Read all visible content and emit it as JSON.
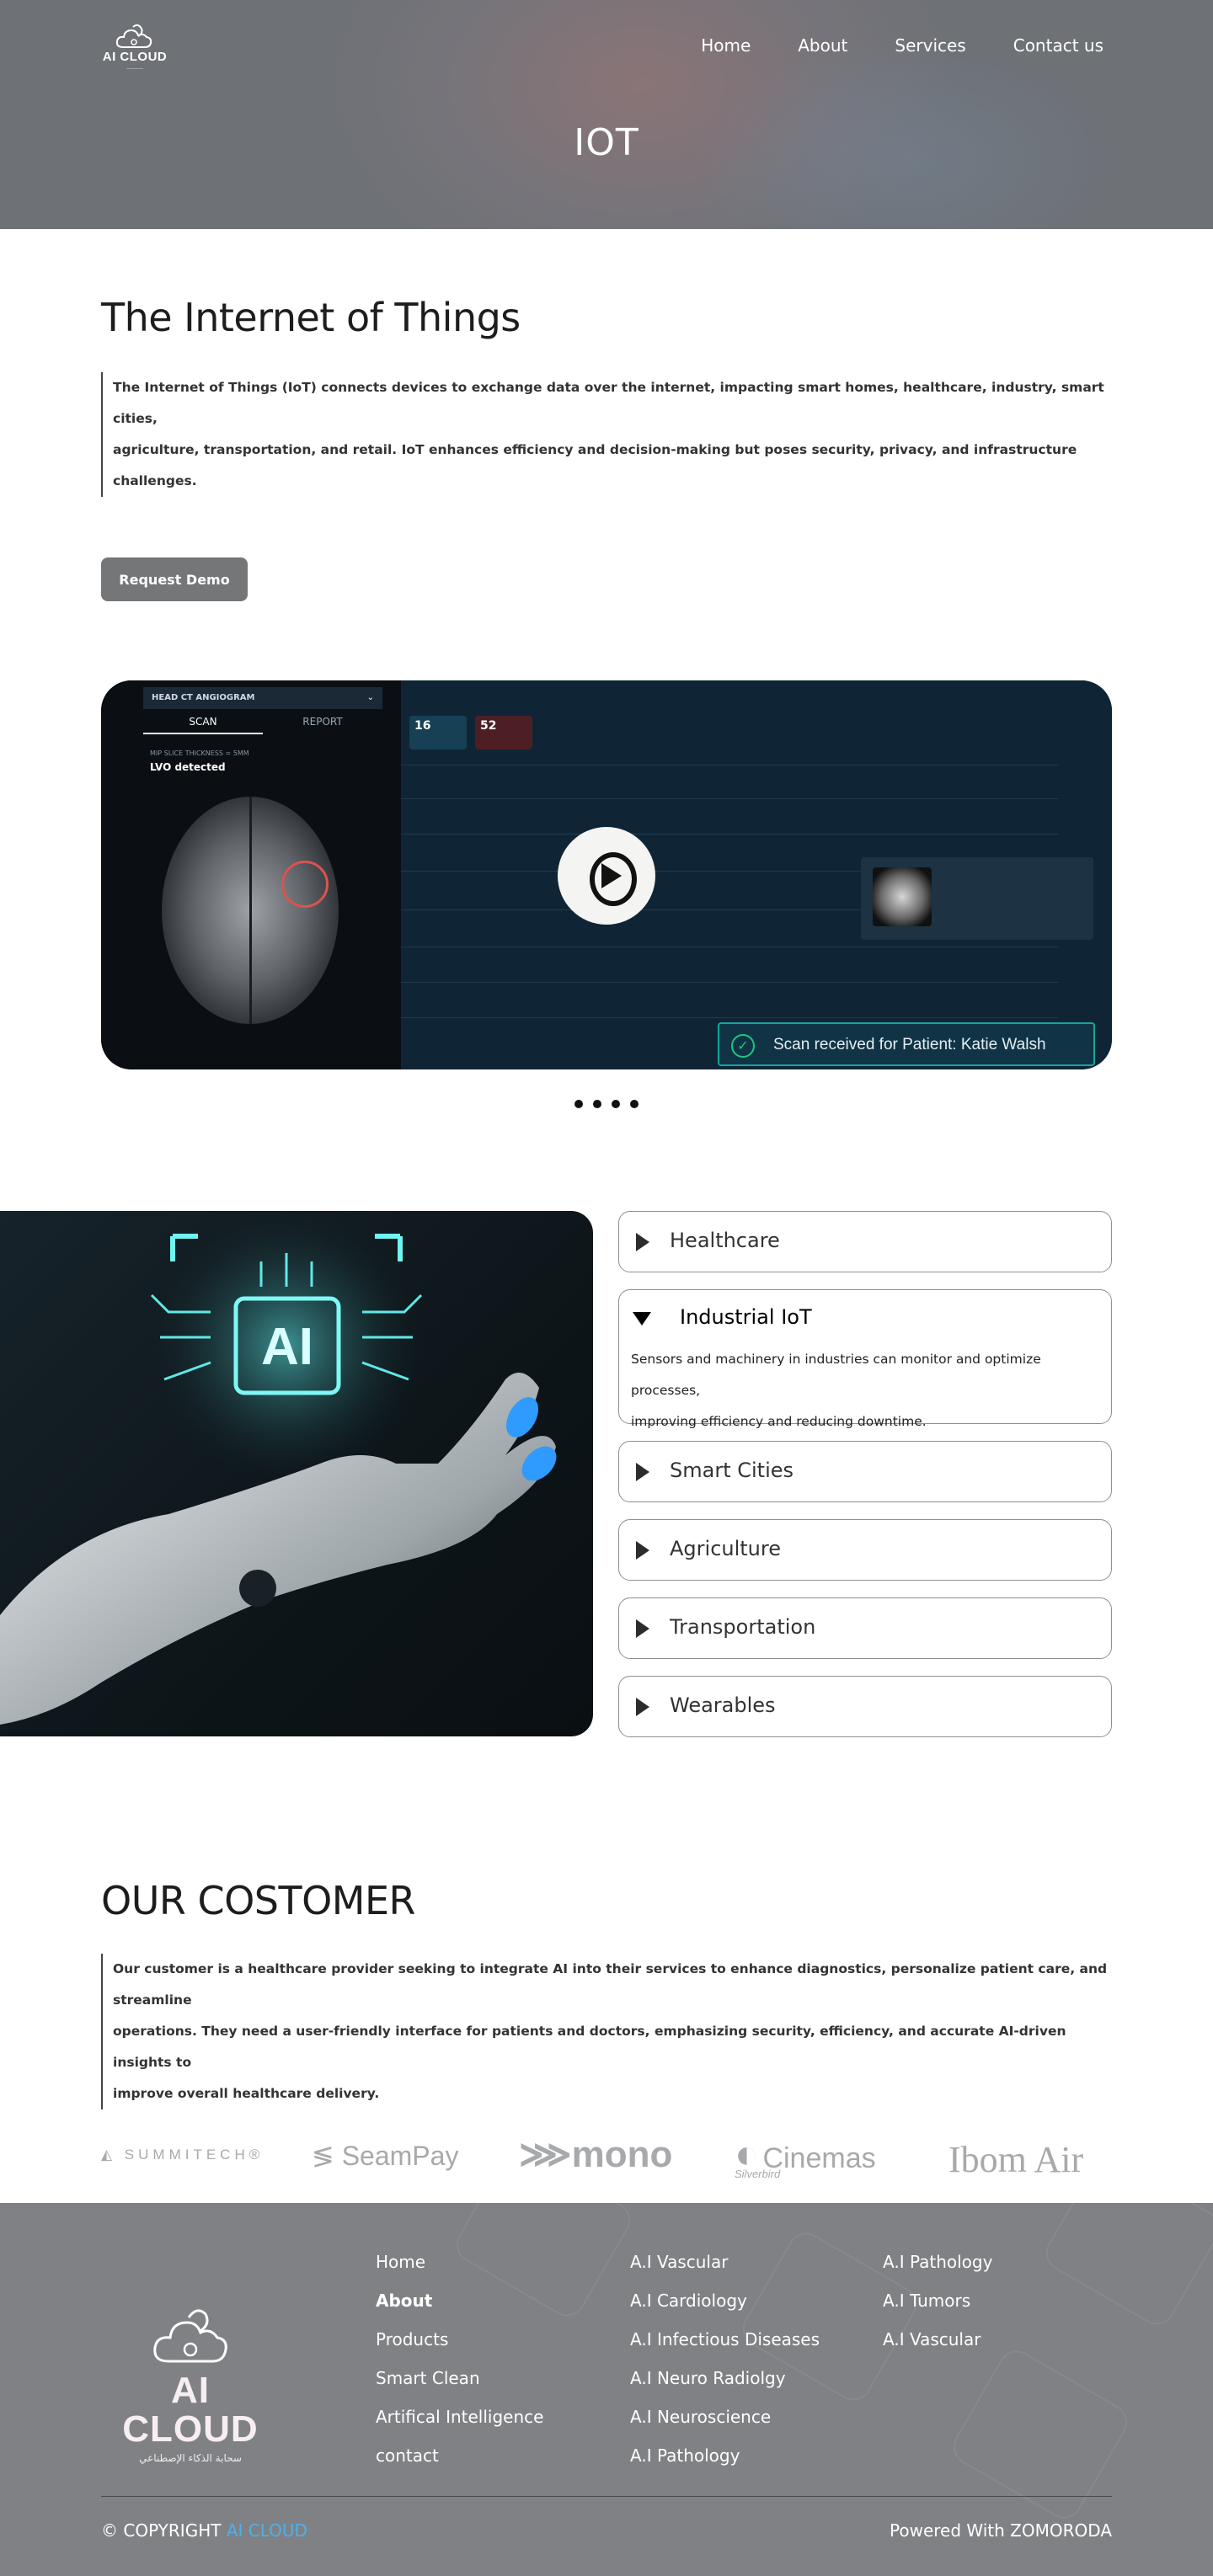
{
  "header": {
    "logo_text": "AI CLOUD",
    "nav": [
      "Home",
      "About",
      "Services",
      "Contact us"
    ],
    "page_title": "IOT"
  },
  "intro": {
    "heading": "The Internet of Things",
    "text_line1": "The Internet of Things (IoT) connects devices to exchange data over the internet, impacting smart homes, healthcare, industry, smart cities,",
    "text_line2": "agriculture, transportation, and retail. IoT enhances efficiency and decision-making but poses security, privacy, and infrastructure challenges.",
    "button_label": "Request Demo"
  },
  "video": {
    "dropdown_label": "HEAD CT ANGIOGRAM",
    "tab_scan": "SCAN",
    "tab_report": "REPORT",
    "tag_small": "MIP SLICE THICKNESS = 5MM",
    "tag_main": "LVO detected",
    "stat1": "16",
    "stat2": "52",
    "toast_text": "Scan received for Patient: Katie Walsh",
    "carousel_dot_count": 4
  },
  "accordion": {
    "items": [
      {
        "label": "Healthcare",
        "open": false
      },
      {
        "label": "Industrial IoT",
        "open": true,
        "body_line1": "Sensors and machinery in industries can monitor and optimize processes,",
        "body_line2": "improving efficiency and reducing downtime."
      },
      {
        "label": "Smart Cities",
        "open": false
      },
      {
        "label": "Agriculture",
        "open": false
      },
      {
        "label": "Transportation",
        "open": false
      },
      {
        "label": "Wearables",
        "open": false
      }
    ],
    "image_text": "AI"
  },
  "customers": {
    "heading": "OUR COSTOMER",
    "text_line1": "Our customer is a healthcare provider seeking to integrate AI into their services to enhance diagnostics, personalize patient care, and streamline",
    "text_line2": "operations. They need a user-friendly interface for patients and doctors, emphasizing security, efficiency, and accurate AI-driven insights to",
    "text_line3": "improve overall healthcare delivery.",
    "logos": [
      "SUMMITECH®",
      "SeamPay",
      "mono",
      "Cinemas",
      "Ibom Air"
    ],
    "logo_sub": "Silverbird"
  },
  "footer": {
    "logo_text": "AI CLOUD",
    "logo_sub": "سحابة الذكاء الإصطناعي",
    "col1": [
      "Home",
      "About",
      "Products",
      "Smart Clean",
      "Artifical Intelligence",
      "contact"
    ],
    "col2": [
      "A.I Vascular",
      "A.I Cardiology",
      "A.I Infectious Diseases",
      "A.I Neuro Radiolgy",
      "A.I Neuroscience",
      "A.I Pathology"
    ],
    "col3": [
      "A.I Pathology",
      "A.I Tumors",
      "A.I Vascular"
    ],
    "copyright_prefix": "© COPYRIGHT",
    "copyright_brand": "AI CLOUD",
    "powered": "Powered With ZOMORODA"
  }
}
